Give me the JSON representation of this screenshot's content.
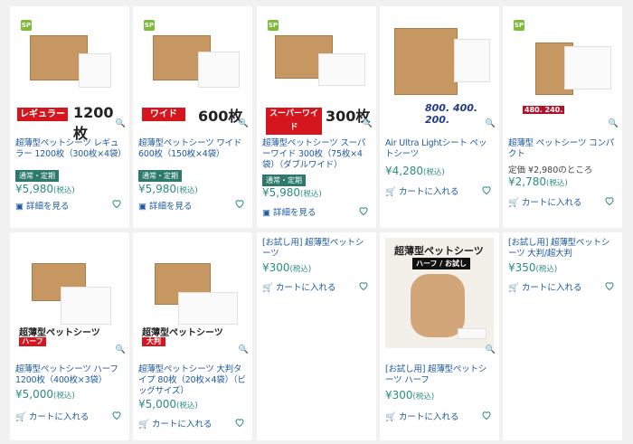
{
  "products": [
    {
      "title": "超薄型ペットシーツ レギュラー 1200枚（300枚×4袋）",
      "tag": "通常・定期",
      "price": "¥5,980",
      "tax": "(税込)",
      "action": "詳細を見る",
      "image_band_label": "レギュラー",
      "image_count": "1200枚"
    },
    {
      "title": "超薄型ペットシーツ ワイド 600枚（150枚×4袋）",
      "tag": "通常・定期",
      "price": "¥5,980",
      "tax": "(税込)",
      "action": "詳細を見る",
      "image_band_label": "ワイド",
      "image_count": "600枚"
    },
    {
      "title": "超薄型ペットシーツ スーパーワイド 300枚（75枚×4袋）（ダブルワイド）",
      "tag": "通常・定期",
      "price": "¥5,980",
      "tax": "(税込)",
      "action": "詳細を見る",
      "image_band_label": "スーパーワイド",
      "image_count": "300枚"
    },
    {
      "title": "Air Ultra Lightシート ペットシーツ",
      "price": "¥4,280",
      "tax": "(税込)",
      "action": "カートに入れる",
      "image_numbers": "800. 400. 200."
    },
    {
      "title": "超薄型 ペットシーツ コンパクト",
      "list_price": "定価 ¥2,980のところ",
      "price": "¥2,780",
      "tax": "(税込)",
      "action": "カートに入れる",
      "image_numbers": "480. 240."
    },
    {
      "title": "超薄型ペットシーツ ハーフ 1200枚（400枚×3袋）",
      "price": "¥5,000",
      "tax": "(税込)",
      "action": "カートに入れる",
      "image_brand": "超薄型ペットシーツ",
      "image_band_label": "ハーフ"
    },
    {
      "title": "超薄型ペットシーツ 大判タイプ 80枚（20枚×4袋）（ビッグサイズ）",
      "price": "¥5,000",
      "tax": "(税込)",
      "action": "カートに入れる",
      "image_brand": "超薄型ペットシーツ",
      "image_band_label": "大判"
    },
    {
      "title": "[お試し用] 超薄型ペットシーツ",
      "price": "¥300",
      "tax": "(税込)",
      "action": "カートに入れる"
    },
    {
      "title": "[お試し用] 超薄型ペットシーツ ハーフ",
      "price": "¥300",
      "tax": "(税込)",
      "action": "カートに入れる",
      "image_brand": "超薄型ペットシーツ",
      "image_band_label": "ハーフ / お試し"
    },
    {
      "title": "[お試し用] 超薄型ペットシーツ 大判/超大判",
      "price": "¥350",
      "tax": "(税込)",
      "action": "カートに入れる"
    }
  ],
  "colors": {
    "accent": "#2c8d83",
    "link": "#1f5aa0",
    "tag_bg": "#2c7a6b",
    "red_band": "#d6161f"
  },
  "icons": {
    "badge": "sp-badge-icon",
    "zoom": "zoom-icon",
    "favorite": "heart-icon",
    "cart": "cart-icon",
    "detail": "detail-icon"
  }
}
